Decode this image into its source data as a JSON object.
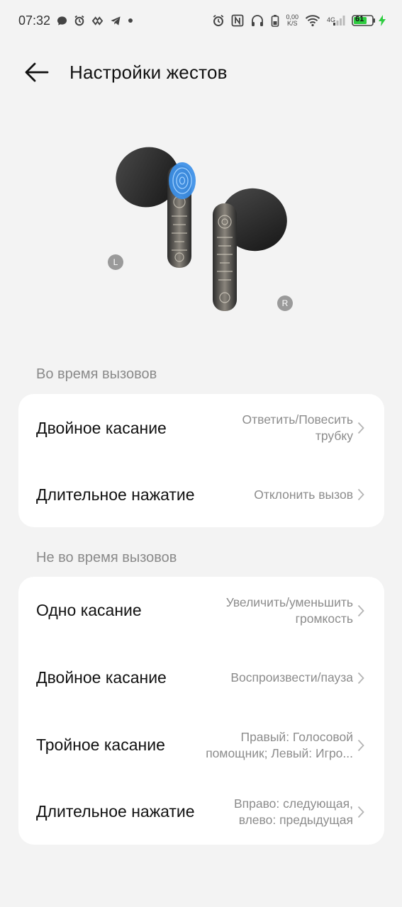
{
  "status_bar": {
    "time": "07:32",
    "net_speed_value": "0,00",
    "net_speed_unit": "K/S",
    "network_type": "4G",
    "battery_level": "61",
    "left_icons": [
      "message-icon",
      "alarm-icon",
      "vpn-icon",
      "telegram-icon",
      "dot-icon"
    ],
    "right_icons": [
      "alarm-icon",
      "nfc-icon",
      "headphones-icon",
      "battery-saver-icon",
      "wifi-icon",
      "signal-icon",
      "battery-icon",
      "charging-icon"
    ]
  },
  "header": {
    "title": "Настройки жестов",
    "back_icon": "arrow-left-icon"
  },
  "earbuds": {
    "left_label": "L",
    "right_label": "R",
    "highlight_color": "#3b8fe8"
  },
  "sections": [
    {
      "label": "Во время вызовов",
      "rows": [
        {
          "label": "Двойное касание",
          "value": "Ответить/Повесить трубку"
        },
        {
          "label": "Длительное нажатие",
          "value": "Отклонить вызов"
        }
      ]
    },
    {
      "label": "Не во время вызовов",
      "rows": [
        {
          "label": "Одно касание",
          "value": "Увеличить/уменьшить громкость"
        },
        {
          "label": "Двойное касание",
          "value": "Воспроизвести/пауза"
        },
        {
          "label": "Тройное касание",
          "value": "Правый: Голосовой помощник; Левый: Игро..."
        },
        {
          "label": "Длительное нажатие",
          "value": "Вправо: следующая, влево: предыдущая"
        }
      ]
    }
  ],
  "colors": {
    "background": "#f3f3f3",
    "card": "#ffffff",
    "section_label": "#8a8a8a",
    "value_text": "#8c8c8c",
    "battery_green": "#2ecc40"
  }
}
